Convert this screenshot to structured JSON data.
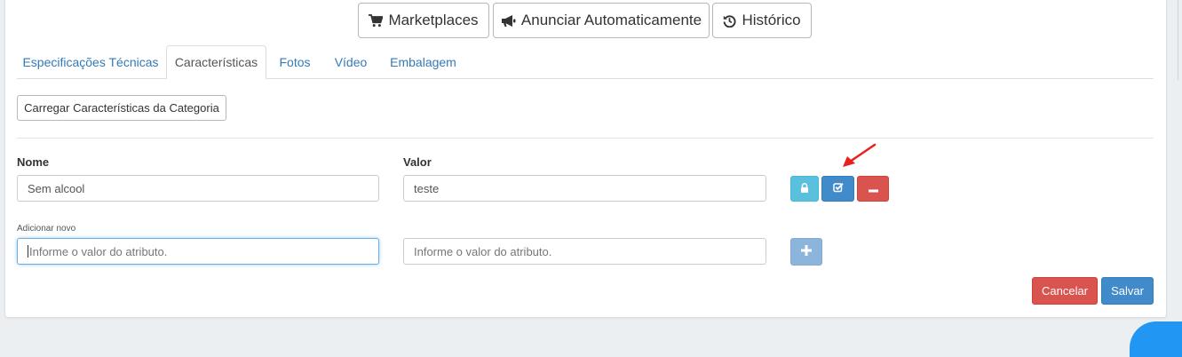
{
  "toolbar": {
    "marketplaces_label": "Marketplaces",
    "anunciar_label": "Anunciar Automaticamente",
    "historico_label": "Histórico"
  },
  "tabs": [
    {
      "label": "Especificações Técnicas",
      "active": false
    },
    {
      "label": "Características",
      "active": true
    },
    {
      "label": "Fotos",
      "active": false
    },
    {
      "label": "Vídeo",
      "active": false
    },
    {
      "label": "Embalagem",
      "active": false
    }
  ],
  "load_button_label": "Carregar Características da Categoria",
  "columns": {
    "name_header": "Nome",
    "value_header": "Valor"
  },
  "attributes": [
    {
      "name": "Sem alcool",
      "value": "teste"
    }
  ],
  "add_new": {
    "label": "Adicionar novo",
    "name_placeholder": "Informe o valor do atributo.",
    "value_placeholder": "Informe o valor do atributo."
  },
  "footer": {
    "cancel_label": "Cancelar",
    "save_label": "Salvar"
  },
  "colors": {
    "link": "#337ab7",
    "info": "#5bc0de",
    "primary": "#428bca",
    "danger": "#d9534f",
    "primary_disabled": "#8db5dc",
    "annotation_arrow": "#e8201e"
  },
  "icons": {
    "marketplaces": "shopping-cart-icon",
    "anunciar": "bullhorn-icon",
    "historico": "history-icon",
    "lock": "lock-icon",
    "edit": "check-square-icon",
    "remove": "minus-icon",
    "add": "plus-icon"
  }
}
